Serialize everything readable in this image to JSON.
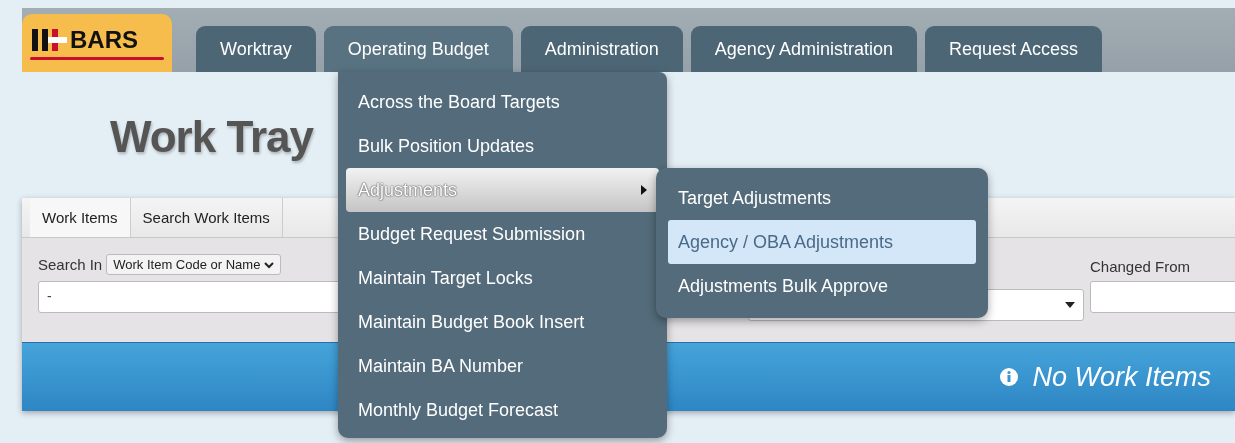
{
  "logo": {
    "text": "BARS"
  },
  "nav_tabs": [
    {
      "label": "Worktray",
      "selected": false
    },
    {
      "label": "Operating Budget",
      "selected": true
    },
    {
      "label": "Administration",
      "selected": false
    },
    {
      "label": "Agency Administration",
      "selected": false
    },
    {
      "label": "Request Access",
      "selected": false
    }
  ],
  "menu": {
    "items": [
      {
        "label": "Across the Board Targets",
        "selected": false,
        "has_submenu": false
      },
      {
        "label": "Bulk Position Updates",
        "selected": false,
        "has_submenu": false
      },
      {
        "label": "Adjustments",
        "selected": true,
        "has_submenu": true
      },
      {
        "label": "Budget Request Submission",
        "selected": false,
        "has_submenu": false
      },
      {
        "label": "Maintain Target Locks",
        "selected": false,
        "has_submenu": false
      },
      {
        "label": "Maintain Budget Book Insert",
        "selected": false,
        "has_submenu": false
      },
      {
        "label": "Maintain BA Number",
        "selected": false,
        "has_submenu": false
      },
      {
        "label": "Monthly Budget Forecast",
        "selected": false,
        "has_submenu": false
      }
    ]
  },
  "submenu": {
    "items": [
      {
        "label": "Target Adjustments",
        "selected": false
      },
      {
        "label": "Agency / OBA Adjustments",
        "selected": true
      },
      {
        "label": "Adjustments Bulk Approve",
        "selected": false
      }
    ]
  },
  "page_title": "Work Tray",
  "panel": {
    "tabs": [
      {
        "label": "Work Items",
        "selected": true
      },
      {
        "label": "Search Work Items",
        "selected": false
      }
    ],
    "search_in_label": "Search In",
    "search_in_select": "Work Item Code or Name",
    "search_value": "-",
    "changed_from_label": "Changed From",
    "message": "No Work Items"
  }
}
